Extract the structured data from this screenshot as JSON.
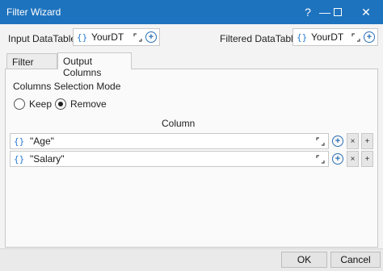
{
  "window": {
    "title": "Filter Wizard",
    "help_glyph": "?",
    "minimize_glyph": "—",
    "maximize_glyph": "☐",
    "close_glyph": "✕"
  },
  "header": {
    "input_label": "Input DataTable",
    "input_value": "YourDT",
    "filtered_label": "Filtered DataTable",
    "filtered_value": "YourDT",
    "brace_glyph": "{}"
  },
  "tabs": [
    {
      "label": "Filter Rows",
      "active": false
    },
    {
      "label": "Output Columns",
      "active": true
    }
  ],
  "panel": {
    "mode_label": "Columns Selection Mode",
    "options": [
      {
        "label": "Keep",
        "checked": false
      },
      {
        "label": "Remove",
        "checked": true
      }
    ],
    "column_header": "Column",
    "rows": [
      {
        "value": "\"Age\""
      },
      {
        "value": "\"Salary\""
      }
    ],
    "remove_glyph": "×",
    "add_glyph": "+"
  },
  "footer": {
    "ok_label": "OK",
    "cancel_label": "Cancel"
  },
  "colors": {
    "titlebar": "#1e73be",
    "accent": "#2a7ad1"
  }
}
